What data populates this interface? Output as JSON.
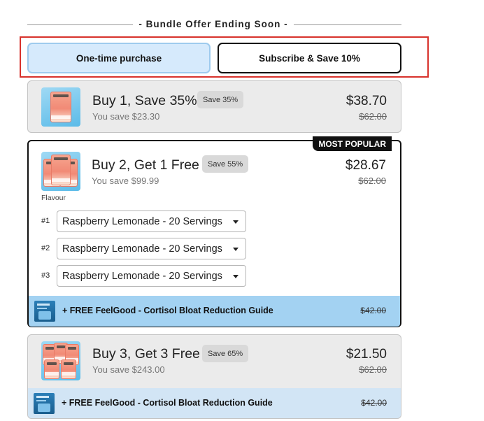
{
  "header": {
    "title": "- Bundle Offer Ending Soon -"
  },
  "purchase_toggle": {
    "one_time_label": "One-time purchase",
    "subscribe_label": "Subscribe & Save 10%",
    "selected": "One-time purchase"
  },
  "bundles": [
    {
      "title": "Buy 1, Save 35%",
      "badge": "Save 35%",
      "you_save": "You save $23.30",
      "price": "$38.70",
      "original_price": "$62.00",
      "selected": false
    },
    {
      "title": "Buy 2, Get 1 Free",
      "badge": "Save 55%",
      "you_save": "You save $99.99",
      "price": "$28.67",
      "original_price": "$62.00",
      "tag": "MOST POPULAR",
      "selected": true,
      "flavour_label": "Flavour",
      "slots": [
        {
          "num": "#1",
          "value": "Raspberry Lemonade - 20 Servings"
        },
        {
          "num": "#2",
          "value": "Raspberry Lemonade - 20 Servings"
        },
        {
          "num": "#3",
          "value": "Raspberry Lemonade - 20 Servings"
        }
      ],
      "gift": {
        "text": "+ FREE FeelGood - Cortisol Bloat Reduction Guide",
        "price": "$42.00"
      }
    },
    {
      "title": "Buy 3, Get 3 Free",
      "badge": "Save 65%",
      "you_save": "You save $243.00",
      "price": "$21.50",
      "original_price": "$62.00",
      "selected": false,
      "gift": {
        "text": "+ FREE FeelGood - Cortisol Bloat Reduction Guide",
        "price": "$42.00"
      }
    }
  ],
  "colors": {
    "selected_toggle_bg": "#d6eafc",
    "highlight_outline": "#d8322c",
    "gift_bar_selected": "#a3d2f2",
    "gift_bar_unselected": "#d2e5f5"
  }
}
